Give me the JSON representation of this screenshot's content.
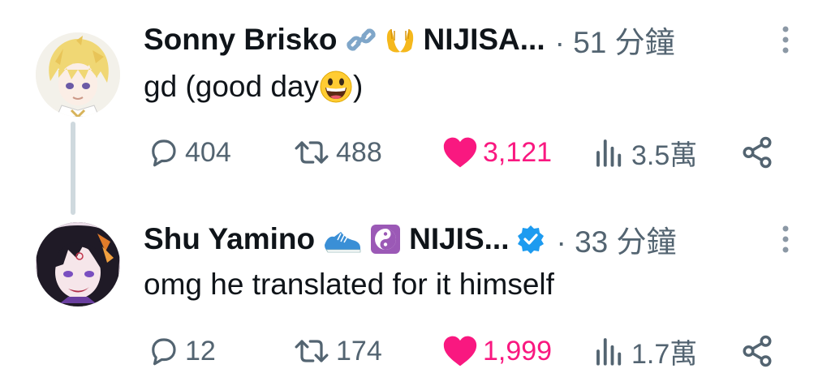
{
  "tweets": [
    {
      "author_name": "Sonny Brisko",
      "author_emojis": [
        "link-emoji",
        "palms-up-emoji"
      ],
      "handle": "NIJISA...",
      "time": "· 51 分鐘",
      "text": "gd (good day",
      "text_suffix": ")",
      "text_emoji": "grinning-face-emoji",
      "replies": "404",
      "retweets": "488",
      "likes": "3,121",
      "views": "3.5萬",
      "liked": true
    },
    {
      "author_name": "Shu Yamino",
      "author_emojis": [
        "running-shoe-emoji",
        "yin-yang-emoji"
      ],
      "handle": "NIJIS...",
      "verified": true,
      "time": "· 33 分鐘",
      "text": "omg he translated for it himself",
      "replies": "12",
      "retweets": "174",
      "likes": "1,999",
      "views": "1.7萬",
      "liked": true
    }
  ],
  "colors": {
    "like": "#f91880",
    "muted": "#536471",
    "text": "#0f1419",
    "verified": "#1d9bf0",
    "thread_line": "#cfd9de"
  }
}
